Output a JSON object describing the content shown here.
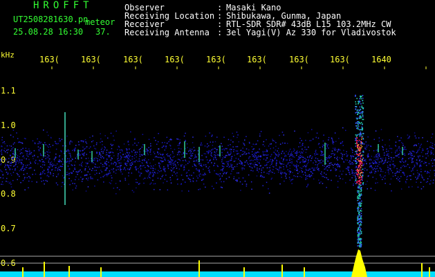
{
  "header": {
    "app_title": "HROFFT",
    "filename": "UT2508281630.pn",
    "meteor_label": "meteor",
    "datetime": "25.08.28 16:30",
    "count": "37.",
    "info": [
      {
        "label": "Observer",
        "value": "Masaki Kano"
      },
      {
        "label": "Receiving Location",
        "value": "Shibukawa, Gunma, Japan"
      },
      {
        "label": "Receiver",
        "value": "RTL-SDR SDR# 43dB L15 103.2MHz CW"
      },
      {
        "label": "Receiving Antenna",
        "value": "3el Yagi(V) Az 330 for Vladivostok"
      }
    ]
  },
  "axes": {
    "y_unit": "kHz",
    "x_ticks": [
      "163(",
      "163(",
      "163(",
      "163(",
      "163(",
      "163(",
      "163(",
      "163(",
      "1640"
    ],
    "y_ticks": [
      "1.1",
      "1.0",
      "0.9",
      "0.8",
      "0.7",
      "0.6"
    ]
  },
  "colors": {
    "background": "#000000",
    "header_title": "#33ff33",
    "header_text": "#ffffff",
    "axis_text": "#ffff33",
    "noise_band": "#1a1acc",
    "meteor_core": "#ff2060",
    "power_trace": "#00ddff",
    "power_spikes": "#ffff00",
    "threshold_line": "#aaaaaa"
  }
}
